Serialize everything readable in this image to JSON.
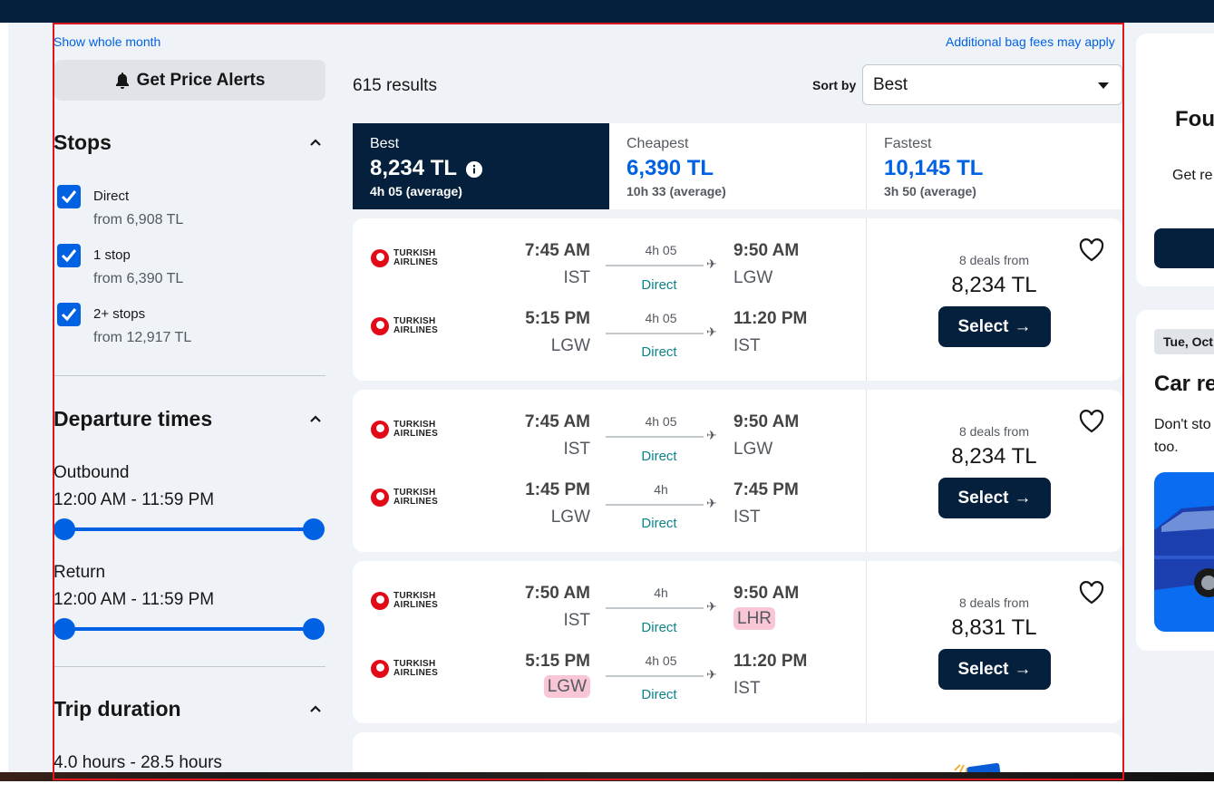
{
  "sidebar": {
    "show_whole_month": "Show whole month",
    "price_alert_label": "Get Price Alerts",
    "stops": {
      "title": "Stops",
      "options": [
        {
          "label": "Direct",
          "sub": "from 6,908 TL"
        },
        {
          "label": "1 stop",
          "sub": "from 6,390 TL"
        },
        {
          "label": "2+ stops",
          "sub": "from 12,917 TL"
        }
      ]
    },
    "departure": {
      "title": "Departure times",
      "outbound_label": "Outbound",
      "outbound_range": "12:00 AM - 11:59 PM",
      "return_label": "Return",
      "return_range": "12:00 AM - 11:59 PM"
    },
    "trip_duration": {
      "title": "Trip duration",
      "range": "4.0 hours - 28.5 hours"
    }
  },
  "results": {
    "bag_fees": "Additional bag fees may apply",
    "count": "615 results",
    "sort_label": "Sort by",
    "sort_value": "Best"
  },
  "tabs": {
    "best": {
      "label": "Best",
      "price": "8,234 TL",
      "duration": "4h 05 (average)"
    },
    "cheapest": {
      "label": "Cheapest",
      "price": "6,390 TL",
      "duration": "10h 33 (average)"
    },
    "fastest": {
      "label": "Fastest",
      "price": "10,145 TL",
      "duration": "3h 50 (average)"
    }
  },
  "flights": [
    {
      "deals": "8 deals from",
      "price": "8,234 TL",
      "select": "Select",
      "legs": [
        {
          "airline": "TURKISH AIRLINES",
          "dep_time": "7:45 AM",
          "dep_code": "IST",
          "duration": "4h 05",
          "stops": "Direct",
          "arr_time": "9:50 AM",
          "arr_code": "LGW"
        },
        {
          "airline": "TURKISH AIRLINES",
          "dep_time": "5:15 PM",
          "dep_code": "LGW",
          "duration": "4h 05",
          "stops": "Direct",
          "arr_time": "11:20 PM",
          "arr_code": "IST"
        }
      ]
    },
    {
      "deals": "8 deals from",
      "price": "8,234 TL",
      "select": "Select",
      "legs": [
        {
          "airline": "TURKISH AIRLINES",
          "dep_time": "7:45 AM",
          "dep_code": "IST",
          "duration": "4h 05",
          "stops": "Direct",
          "arr_time": "9:50 AM",
          "arr_code": "LGW"
        },
        {
          "airline": "TURKISH AIRLINES",
          "dep_time": "1:45 PM",
          "dep_code": "LGW",
          "duration": "4h",
          "stops": "Direct",
          "arr_time": "7:45 PM",
          "arr_code": "IST"
        }
      ]
    },
    {
      "deals": "8 deals from",
      "price": "8,831 TL",
      "select": "Select",
      "legs": [
        {
          "airline": "TURKISH AIRLINES",
          "dep_time": "7:50 AM",
          "dep_code": "IST",
          "duration": "4h",
          "stops": "Direct",
          "arr_time": "9:50 AM",
          "arr_code": "LHR"
        },
        {
          "airline": "TURKISH AIRLINES",
          "dep_time": "5:15 PM",
          "dep_code": "LGW",
          "duration": "4h 05",
          "stops": "Direct",
          "arr_time": "11:20 PM",
          "arr_code": "IST"
        }
      ]
    }
  ],
  "right_panel": {
    "card1_title": "Fou",
    "card1_text": "Get re",
    "date_badge": "Tue, Oct",
    "car_title": "Car re",
    "car_text_1": "Don't sto",
    "car_text_2": "too."
  },
  "colors": {
    "brand_dark": "#05203c",
    "accent_blue": "#0062e3",
    "direct_teal": "#0c838a",
    "airport_highlight": "#f9c6d6"
  }
}
